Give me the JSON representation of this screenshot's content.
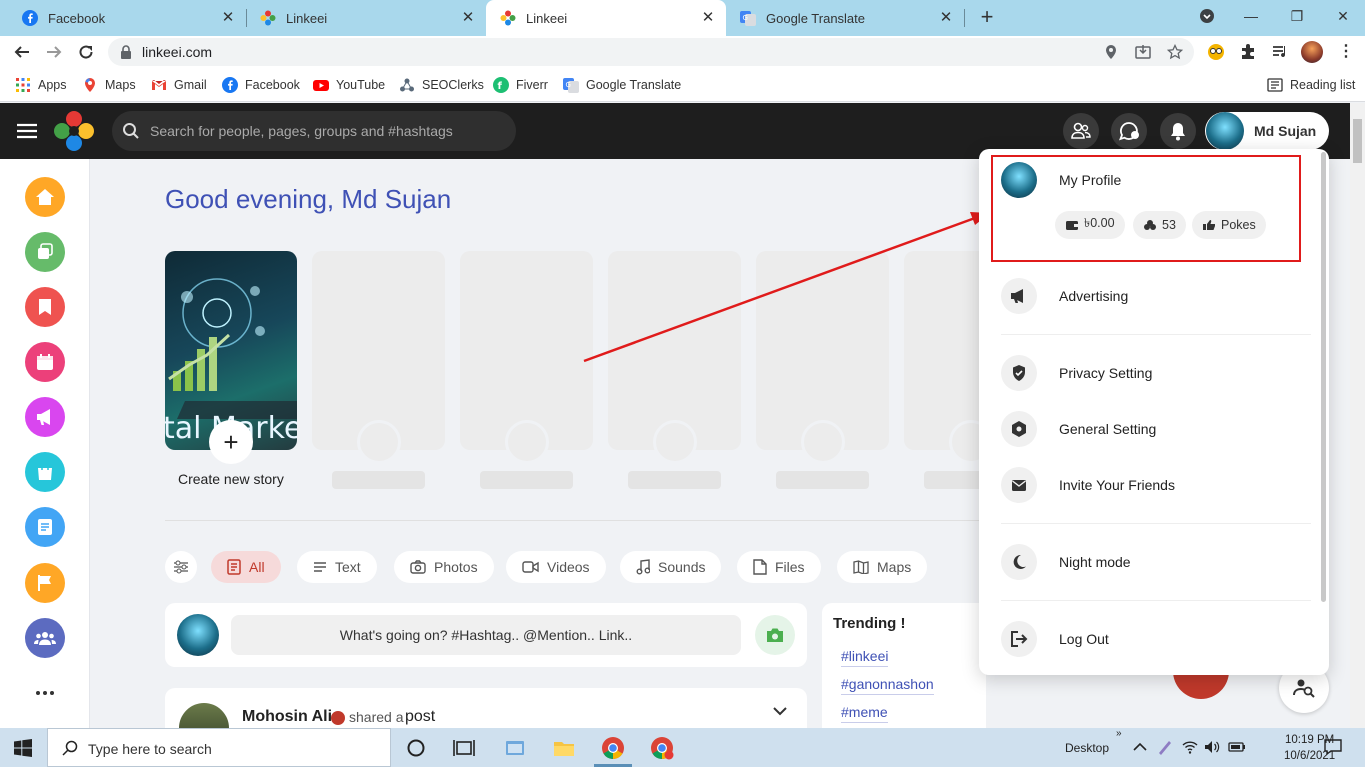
{
  "browser": {
    "tabs": [
      {
        "title": "Facebook",
        "active": false
      },
      {
        "title": "Linkeei",
        "active": false
      },
      {
        "title": "Linkeei",
        "active": true
      },
      {
        "title": "Google Translate",
        "active": false
      }
    ],
    "url": "linkeei.com",
    "bookmarks": [
      "Apps",
      "Maps",
      "Gmail",
      "Facebook",
      "YouTube",
      "SEOClerks",
      "Fiverr",
      "Google Translate"
    ],
    "reading_list": "Reading list"
  },
  "site": {
    "search_placeholder": "Search for people, pages, groups and #hashtags",
    "user_name": "Md Sujan",
    "greeting": "Good evening, Md Sujan",
    "story": {
      "create_label": "Create new story",
      "add_symbol": "+",
      "image_text": "tal Marke"
    },
    "filters": [
      "All",
      "Text",
      "Photos",
      "Videos",
      "Sounds",
      "Files",
      "Maps"
    ],
    "composer_placeholder": "What's going on? #Hashtag.. @Mention.. Link..",
    "post": {
      "author": "Mohosin Ali",
      "shared_text": "shared a",
      "kind": "post"
    },
    "trending": {
      "title": "Trending !",
      "tags": [
        "#linkeei",
        "#ganonnashon",
        "#meme"
      ]
    }
  },
  "menu": {
    "profile_label": "My Profile",
    "wallet": "৳0.00",
    "points": "53",
    "pokes": "Pokes",
    "items": [
      "Advertising",
      "Privacy Setting",
      "General Setting",
      "Invite Your Friends",
      "Night mode",
      "Log Out"
    ]
  },
  "taskbar": {
    "search_text": "Type here to search",
    "desktop": "Desktop",
    "time": "10:19 PM",
    "date": "10/6/2021"
  },
  "colors": {
    "accent": "#3f51b5",
    "danger": "#e01b1b",
    "header_bg": "#1e1e1e"
  }
}
